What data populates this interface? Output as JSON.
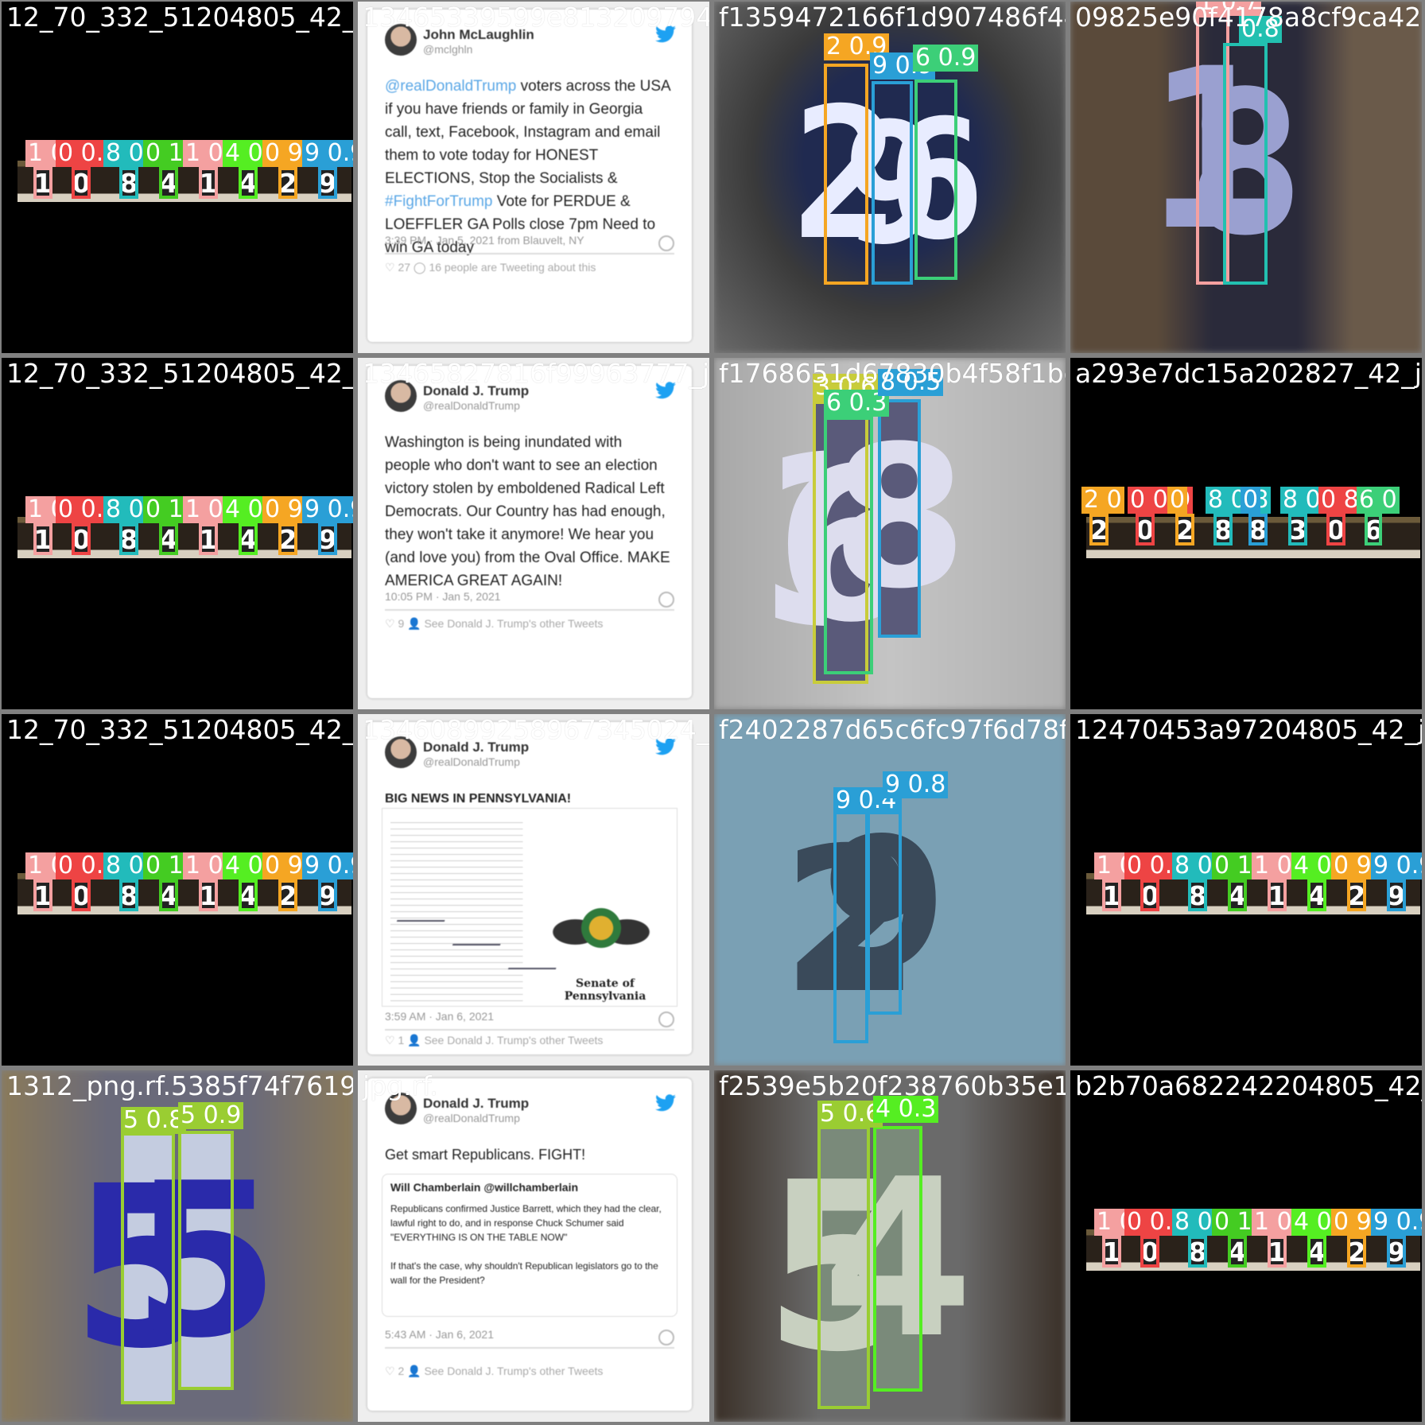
{
  "grid": {
    "rows": 4,
    "cols": 4
  },
  "tiles": [
    {
      "file": "12_70_332_51204805_42_jpg.rf.",
      "overlay_file": "",
      "type": "scoreboard",
      "detections": [
        {
          "label": "1 0.8",
          "digit": "1",
          "color": "#f4a0a0"
        },
        {
          "label": "0 0.8",
          "digit": "0",
          "color": "#ee4444"
        },
        {
          "label": "8 0.8",
          "digit": "8",
          "color": "#22bbbb"
        },
        {
          "label": "0 1",
          "digit": "4",
          "color": "#44cc22"
        },
        {
          "label": "1 0.8",
          "digit": "1",
          "color": "#f4a0a0"
        },
        {
          "label": "4 0.8",
          "digit": "4",
          "color": "#55ee22"
        },
        {
          "label": "0 9",
          "digit": "2",
          "color": "#f5a623"
        },
        {
          "label": "9 0.9",
          "digit": "9",
          "color": "#2a9fd6"
        }
      ]
    },
    {
      "file": "13465339599e813209794_jpg.rf.",
      "overlay_file": "",
      "type": "tweet",
      "tweet": {
        "name": "John McLaughlin",
        "handle": "@mclghln",
        "text_parts": [
          {
            "t": "@realDonaldTrump",
            "hl": true
          },
          {
            "t": " voters across the USA if you have friends or family in Georgia call, text, Facebook, Instagram and email them to vote today for HONEST ELECTIONS, Stop the Socialists & ",
            "hl": false
          },
          {
            "t": "#FightForTrump",
            "hl": true
          },
          {
            "t": " Vote for PERDUE & LOEFFLER GA Polls close 7pm Need to win GA today",
            "hl": false
          }
        ],
        "meta": "3:39 PM · Jan 5, 2021 from Blauvelt, NY",
        "footer": "♡ 27   ◯ 16 people are Tweeting about this"
      }
    },
    {
      "file": "f1359472166f1d907486f44e06",
      "overlay_file": "",
      "type": "house",
      "detections": [
        {
          "label": "2 0.9",
          "digit": "2",
          "color": "#f5a623"
        },
        {
          "label": "9 0.9",
          "digit": "9",
          "color": "#2a9fd6"
        },
        {
          "label": "6 0.9",
          "digit": "6",
          "color": "#3ccf78"
        }
      ]
    },
    {
      "file": "09825e90f4178a8cf9ca42",
      "overlay_file": "",
      "type": "house-dark",
      "detections": [
        {
          "label": "1 0.7",
          "digit": "1",
          "color": "#f4a0a0"
        },
        {
          "label": "0.8",
          "digit": "8",
          "color": "#22c0b0"
        }
      ]
    },
    {
      "file": "12_70_332_51204805_42_jpg.rf.",
      "overlay_file": "",
      "type": "scoreboard",
      "detections": [
        {
          "label": "1 0.8",
          "digit": "1",
          "color": "#f4a0a0"
        },
        {
          "label": "0 0.8",
          "digit": "0",
          "color": "#ee4444"
        },
        {
          "label": "8 0.8",
          "digit": "8",
          "color": "#22bbbb"
        },
        {
          "label": "0 1",
          "digit": "4",
          "color": "#44cc22"
        },
        {
          "label": "1 0.8",
          "digit": "1",
          "color": "#f4a0a0"
        },
        {
          "label": "4 0.8",
          "digit": "4",
          "color": "#55ee22"
        },
        {
          "label": "0 9",
          "digit": "2",
          "color": "#f5a623"
        },
        {
          "label": "9 0.9",
          "digit": "9",
          "color": "#2a9fd6"
        }
      ]
    },
    {
      "file": "13465827816f99963777_jpg.rf.",
      "overlay_file": "",
      "type": "tweet",
      "tweet": {
        "name": "Donald J. Trump",
        "handle": "@realDonaldTrump",
        "text_parts": [
          {
            "t": "Washington is being inundated with people who don't want to see an election victory stolen by emboldened Radical Left Democrats. Our Country has had enough, they won't take it anymore! We hear you (and love you) from the Oval Office. MAKE AMERICA GREAT AGAIN!",
            "hl": false
          }
        ],
        "meta": "10:05 PM · Jan 5, 2021",
        "footer": "♡ 9   👤 See Donald J. Trump's other Tweets"
      }
    },
    {
      "file": "f1768651d67830b4f58f1bc",
      "overlay_file": "",
      "type": "house-grey",
      "detections": [
        {
          "label": "3 0.6",
          "digit": "3",
          "color": "#c8cc3a"
        },
        {
          "label": "6 0.3",
          "digit": "6",
          "color": "#3ccf78"
        },
        {
          "label": "8 0.5",
          "digit": "8",
          "color": "#2a9fd6"
        }
      ]
    },
    {
      "file": "a293e7dc15a202827_42_jp",
      "overlay_file": "",
      "type": "scoreboard2",
      "detections": [
        {
          "label": "2 0",
          "digit": "2",
          "color": "#f5a623"
        },
        {
          "label": "0 0.9",
          "digit": "0",
          "color": "#ee4444"
        },
        {
          "label": "0",
          "digit": "2",
          "color": "#f5a623"
        },
        {
          "label": "8 0.8",
          "digit": "8",
          "color": "#22bbbb"
        },
        {
          "label": "0",
          "digit": "8",
          "color": "#2a9fd6"
        },
        {
          "label": "8 0.3",
          "digit": "3",
          "color": "#22bbbb"
        },
        {
          "label": "0 8",
          "digit": "0",
          "color": "#ee4444"
        },
        {
          "label": "6 0",
          "digit": "6",
          "color": "#3ccf78"
        }
      ]
    },
    {
      "file": "12_70_332_51204805_42_jpg.rf.",
      "overlay_file": "",
      "type": "scoreboard",
      "detections": [
        {
          "label": "1 0.8",
          "digit": "1",
          "color": "#f4a0a0"
        },
        {
          "label": "0 0.8",
          "digit": "0",
          "color": "#ee4444"
        },
        {
          "label": "8 0.8",
          "digit": "8",
          "color": "#22bbbb"
        },
        {
          "label": "0 1",
          "digit": "4",
          "color": "#44cc22"
        },
        {
          "label": "1 0.8",
          "digit": "1",
          "color": "#f4a0a0"
        },
        {
          "label": "4 0.8",
          "digit": "4",
          "color": "#55ee22"
        },
        {
          "label": "0 9",
          "digit": "2",
          "color": "#f5a623"
        },
        {
          "label": "9 0.9",
          "digit": "9",
          "color": "#2a9fd6"
        }
      ]
    },
    {
      "file": "13460899258967345024_jpg.rf.",
      "overlay_file": "",
      "type": "tweet-doc",
      "tweet": {
        "name": "Donald J. Trump",
        "handle": "@realDonaldTrump",
        "text_parts": [
          {
            "t": "BIG NEWS IN PENNSYLVANIA!",
            "hl": false
          }
        ],
        "meta": "3:59 AM · Jan 6, 2021",
        "footer": "♡ 1   👤 See Donald J. Trump's other Tweets",
        "seal_caption": "Senate of Pennsylvania"
      }
    },
    {
      "file": "f2402287d65c6fc97f6d78f",
      "overlay_file": "",
      "type": "house-blue",
      "detections": [
        {
          "label": "9 0.4",
          "digit": "2",
          "color": "#2a9fd6"
        },
        {
          "label": "9 0.8",
          "digit": "9",
          "color": "#2a9fd6"
        }
      ]
    },
    {
      "file": "12470453a97204805_42_jp",
      "overlay_file": "",
      "type": "scoreboard",
      "detections": [
        {
          "label": "1 0.8",
          "digit": "1",
          "color": "#f4a0a0"
        },
        {
          "label": "0 0.8",
          "digit": "0",
          "color": "#ee4444"
        },
        {
          "label": "8 0.8",
          "digit": "8",
          "color": "#22bbbb"
        },
        {
          "label": "0 1",
          "digit": "4",
          "color": "#44cc22"
        },
        {
          "label": "1 0.8",
          "digit": "1",
          "color": "#f4a0a0"
        },
        {
          "label": "4 0.8",
          "digit": "4",
          "color": "#55ee22"
        },
        {
          "label": "0 9",
          "digit": "2",
          "color": "#f5a623"
        },
        {
          "label": "9 0.9",
          "digit": "9",
          "color": "#2a9fd6"
        }
      ]
    },
    {
      "file": "1312_png.rf.5385f74f76191439866988406088305280",
      "overlay_file": "",
      "type": "house-55",
      "detections": [
        {
          "label": "5 0.8",
          "digit": "5",
          "color": "#9acd32"
        },
        {
          "label": "5 0.9",
          "digit": "5",
          "color": "#9acd32"
        }
      ]
    },
    {
      "file": "jpg.rf.",
      "overlay_file": "",
      "type": "tweet-quote",
      "tweet": {
        "name": "Donald J. Trump",
        "handle": "@realDonaldTrump",
        "text_parts": [
          {
            "t": "Get smart Republicans. FIGHT!",
            "hl": false
          }
        ],
        "quote_name": "Will Chamberlain",
        "quote_handle": "@willchamberlain",
        "quote_text": "Republicans confirmed Justice Barrett, which they had the clear, lawful right to do, and in response Chuck Schumer said \"EVERYTHING IS ON THE TABLE NOW\"\n\nIf that's the case, why shouldn't Republican legislators go to the wall for the President?",
        "meta": "5:43 AM · Jan 6, 2021",
        "footer": "♡ 2   👤 See Donald J. Trump's other Tweets"
      }
    },
    {
      "file": "f2539e5b20f238760b35e11",
      "overlay_file": "",
      "type": "house-54",
      "detections": [
        {
          "label": "5 0.6",
          "digit": "5",
          "color": "#9acd32"
        },
        {
          "label": "4 0.3",
          "digit": "4",
          "color": "#55ee22"
        }
      ]
    },
    {
      "file": "b2b70a682242204805_42_jp",
      "overlay_file": "",
      "type": "scoreboard",
      "detections": [
        {
          "label": "1 0.8",
          "digit": "1",
          "color": "#f4a0a0"
        },
        {
          "label": "0 0.8",
          "digit": "0",
          "color": "#ee4444"
        },
        {
          "label": "8 0.8",
          "digit": "8",
          "color": "#22bbbb"
        },
        {
          "label": "0 1",
          "digit": "4",
          "color": "#44cc22"
        },
        {
          "label": "1 0.8",
          "digit": "1",
          "color": "#f4a0a0"
        },
        {
          "label": "4 0.8",
          "digit": "4",
          "color": "#55ee22"
        },
        {
          "label": "0 9",
          "digit": "2",
          "color": "#f5a623"
        },
        {
          "label": "9 0.9",
          "digit": "9",
          "color": "#2a9fd6"
        }
      ]
    }
  ]
}
